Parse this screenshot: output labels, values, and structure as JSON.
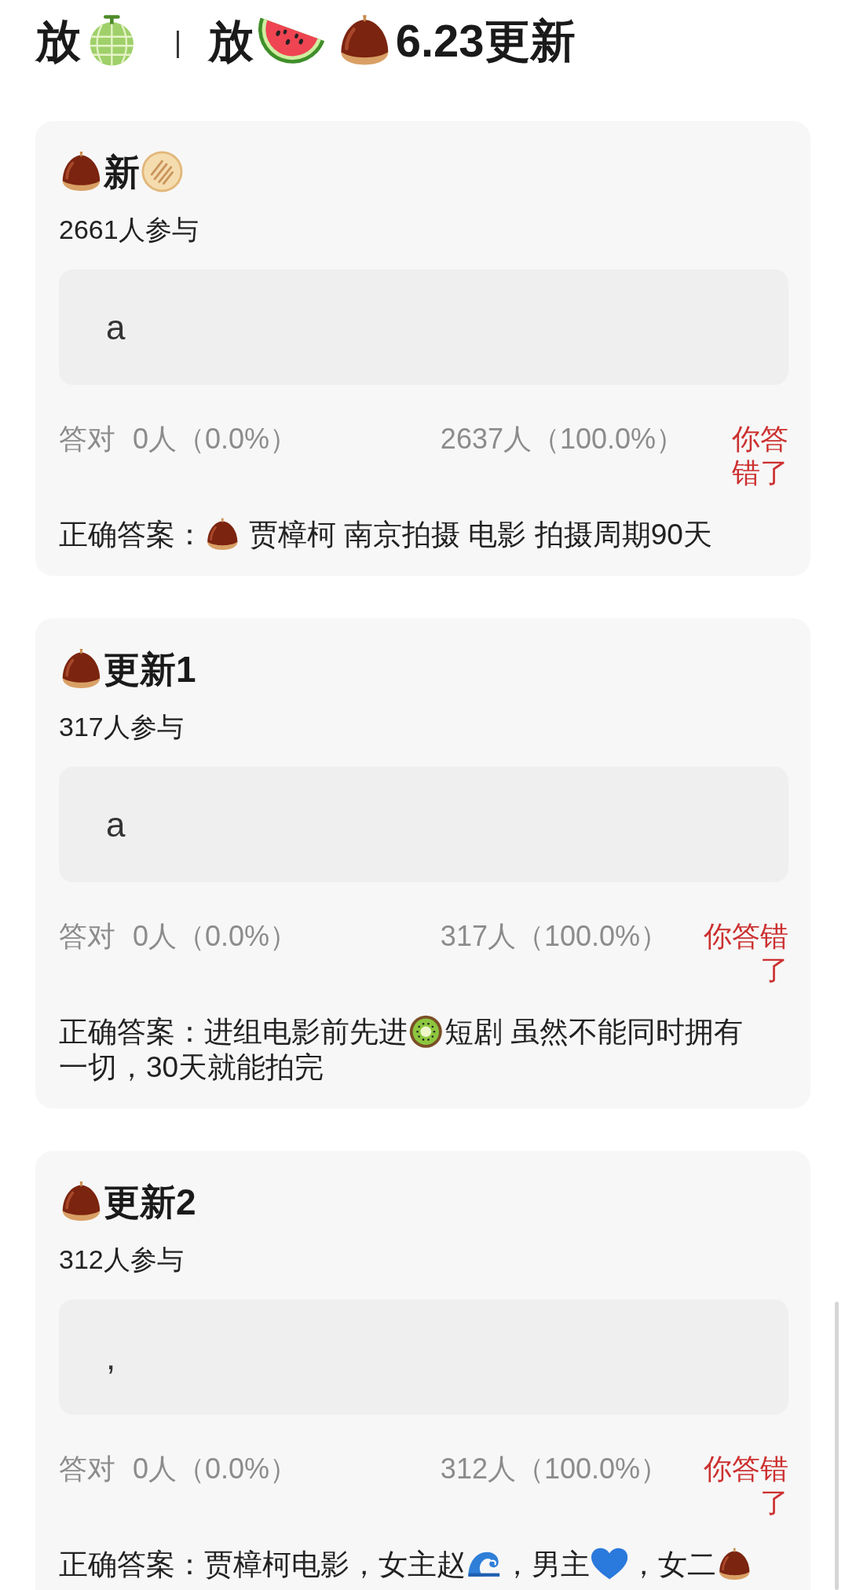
{
  "header": {
    "title": [
      {
        "kind": "text",
        "text": "放"
      },
      {
        "kind": "melon"
      },
      {
        "kind": "separator",
        "text": "|"
      },
      {
        "kind": "text",
        "text": "放"
      },
      {
        "kind": "watermelon"
      },
      {
        "kind": "chestnut"
      },
      {
        "kind": "text",
        "text": "6.23更新"
      }
    ]
  },
  "quizzes": [
    {
      "title": [
        {
          "kind": "chestnut"
        },
        {
          "kind": "text",
          "text": "新"
        },
        {
          "kind": "flatbread"
        }
      ],
      "participants": "2661人参与",
      "answer": "a",
      "correct_label": "答对",
      "correct_stat": "0人（0.0%）",
      "other_stat": "2637人（100.0%）",
      "result": {
        "text": "你答错了",
        "correct": false
      },
      "solution": [
        {
          "kind": "text",
          "text": "正确答案："
        },
        {
          "kind": "chestnut"
        },
        {
          "kind": "text",
          "text": " 贾樟柯 南京拍摄 电影 拍摄周期90天"
        }
      ]
    },
    {
      "title": [
        {
          "kind": "chestnut"
        },
        {
          "kind": "text",
          "text": "更新1"
        }
      ],
      "participants": "317人参与",
      "answer": "a",
      "correct_label": "答对",
      "correct_stat": "0人（0.0%）",
      "other_stat": "317人（100.0%）",
      "result": {
        "text": "你答错了",
        "correct": false
      },
      "solution": [
        {
          "kind": "text",
          "text": "正确答案：进组电影前先进"
        },
        {
          "kind": "kiwi"
        },
        {
          "kind": "text",
          "text": "短剧 虽然不能同时拥有"
        },
        {
          "kind": "text",
          "text": "一切，30天就能拍完"
        }
      ]
    },
    {
      "title": [
        {
          "kind": "chestnut"
        },
        {
          "kind": "text",
          "text": "更新2"
        }
      ],
      "participants": "312人参与",
      "answer": ",",
      "correct_label": "答对",
      "correct_stat": "0人（0.0%）",
      "other_stat": "312人（100.0%）",
      "result": {
        "text": "你答错了",
        "correct": false
      },
      "solution": [
        {
          "kind": "text",
          "text": "正确答案：贾樟柯电影，女主赵"
        },
        {
          "kind": "wave"
        },
        {
          "kind": "text",
          "text": "，男主"
        },
        {
          "kind": "heart"
        },
        {
          "kind": "text",
          "text": "，女二"
        },
        {
          "kind": "chestnut"
        }
      ]
    }
  ]
}
